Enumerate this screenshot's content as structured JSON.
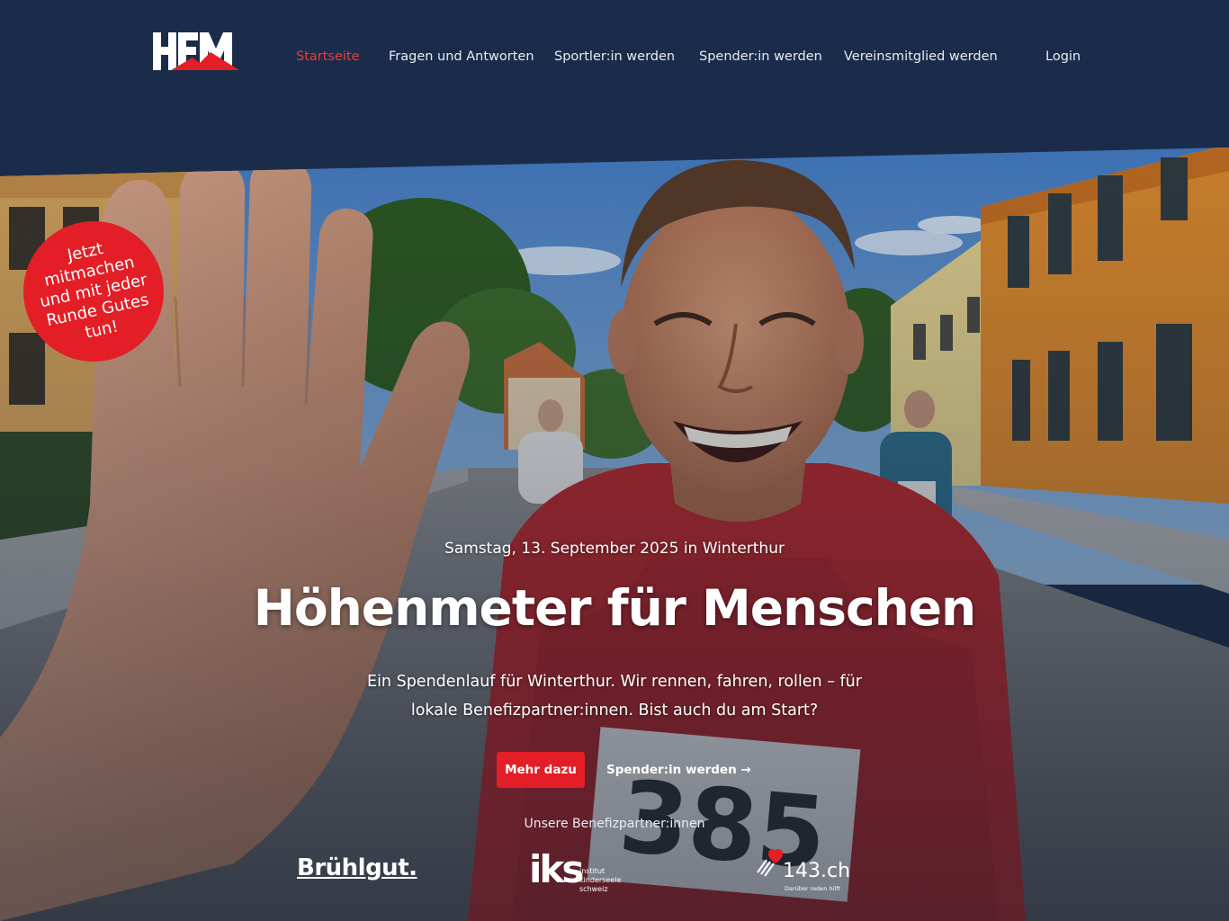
{
  "header": {
    "logo_text": "HFM",
    "nav": [
      {
        "label": "Startseite",
        "active": true
      },
      {
        "label": "Fragen und Antworten",
        "active": false
      },
      {
        "label": "Sportler:in werden",
        "active": false
      },
      {
        "label": "Spender:in werden",
        "active": false
      },
      {
        "label": "Vereinsmitglied werden",
        "active": false
      }
    ],
    "login_label": "Login"
  },
  "badge": {
    "text": "Jetzt mitmachen und mit jeder Runde Gutes tun!"
  },
  "hero": {
    "subline": "Samstag, 13. September 2025 in Winterthur",
    "headline": "Höhenmeter für Menschen",
    "description": "Ein Spendenlauf für Winterthur. Wir rennen, fahren, rollen – für lokale Benefizpartner:innen. Bist auch du am Start?",
    "primary_cta": "Mehr dazu",
    "secondary_cta": "Spender:in werden →",
    "bib_number": "385"
  },
  "partners": {
    "title": "Unsere Benefizpartner:innen",
    "items": [
      {
        "name": "Brühlgut."
      },
      {
        "mark": "iks",
        "name": "institut kinderseele schweiz"
      },
      {
        "name": "143.ch",
        "tagline": "Darüber reden hilft"
      }
    ]
  },
  "colors": {
    "header_bg": "#1b2c4a",
    "accent": "#e41e26",
    "active_nav": "#ef3a3a",
    "text": "#ffffff"
  }
}
